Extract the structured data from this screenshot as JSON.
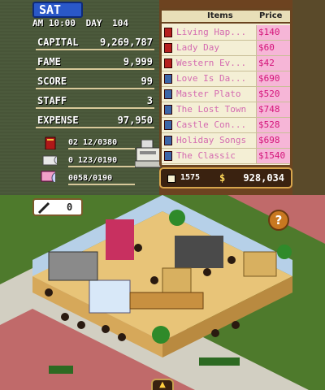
{
  "header": {
    "day_of_week": "SAT",
    "time": "AM 10:00",
    "day_label": "DAY",
    "day_number": "104"
  },
  "stats": [
    {
      "label": "CAPITAL",
      "value": "9,269,787"
    },
    {
      "label": "FAME",
      "value": "9,999"
    },
    {
      "label": "SCORE",
      "value": "99"
    },
    {
      "label": "STAFF",
      "value": "3"
    },
    {
      "label": "EXPENSE",
      "value": "97,950"
    }
  ],
  "inventory": [
    {
      "icon": "book-icon",
      "value": "02 12/0380"
    },
    {
      "icon": "cd-icon",
      "value": "0 123/0190"
    },
    {
      "icon": "dvd-icon",
      "value": "0058/0190"
    }
  ],
  "item_list": {
    "header_items": "Items",
    "header_price": "Price",
    "rows": [
      {
        "icon": "book-icon",
        "title": "Living Hap...",
        "price": "$140"
      },
      {
        "icon": "book-icon",
        "title": "Lady Day",
        "price": "$60"
      },
      {
        "icon": "book-icon",
        "title": "Western Ev...",
        "price": "$42"
      },
      {
        "icon": "dvd-icon",
        "title": "Love Is Da...",
        "price": "$690"
      },
      {
        "icon": "dvd-icon",
        "title": "Master Plato",
        "price": "$520"
      },
      {
        "icon": "dvd-icon",
        "title": "The Lost Town",
        "price": "$748"
      },
      {
        "icon": "dvd-icon",
        "title": "Castle Con...",
        "price": "$528"
      },
      {
        "icon": "dvd-icon",
        "title": "Holiday Songs",
        "price": "$698"
      },
      {
        "icon": "dvd-icon",
        "title": "The Classic",
        "price": "$1540"
      }
    ],
    "footer_count": "1575",
    "footer_currency": "$",
    "footer_total": "928,034"
  },
  "bottom": {
    "staff_count": "0",
    "help_label": "?",
    "scroll_label": "▲"
  },
  "colors": {
    "panel": "#4c5a3c",
    "badge": "#2a58c8",
    "price_bg": "#f6b6d7",
    "title_text": "#d46bb0"
  }
}
